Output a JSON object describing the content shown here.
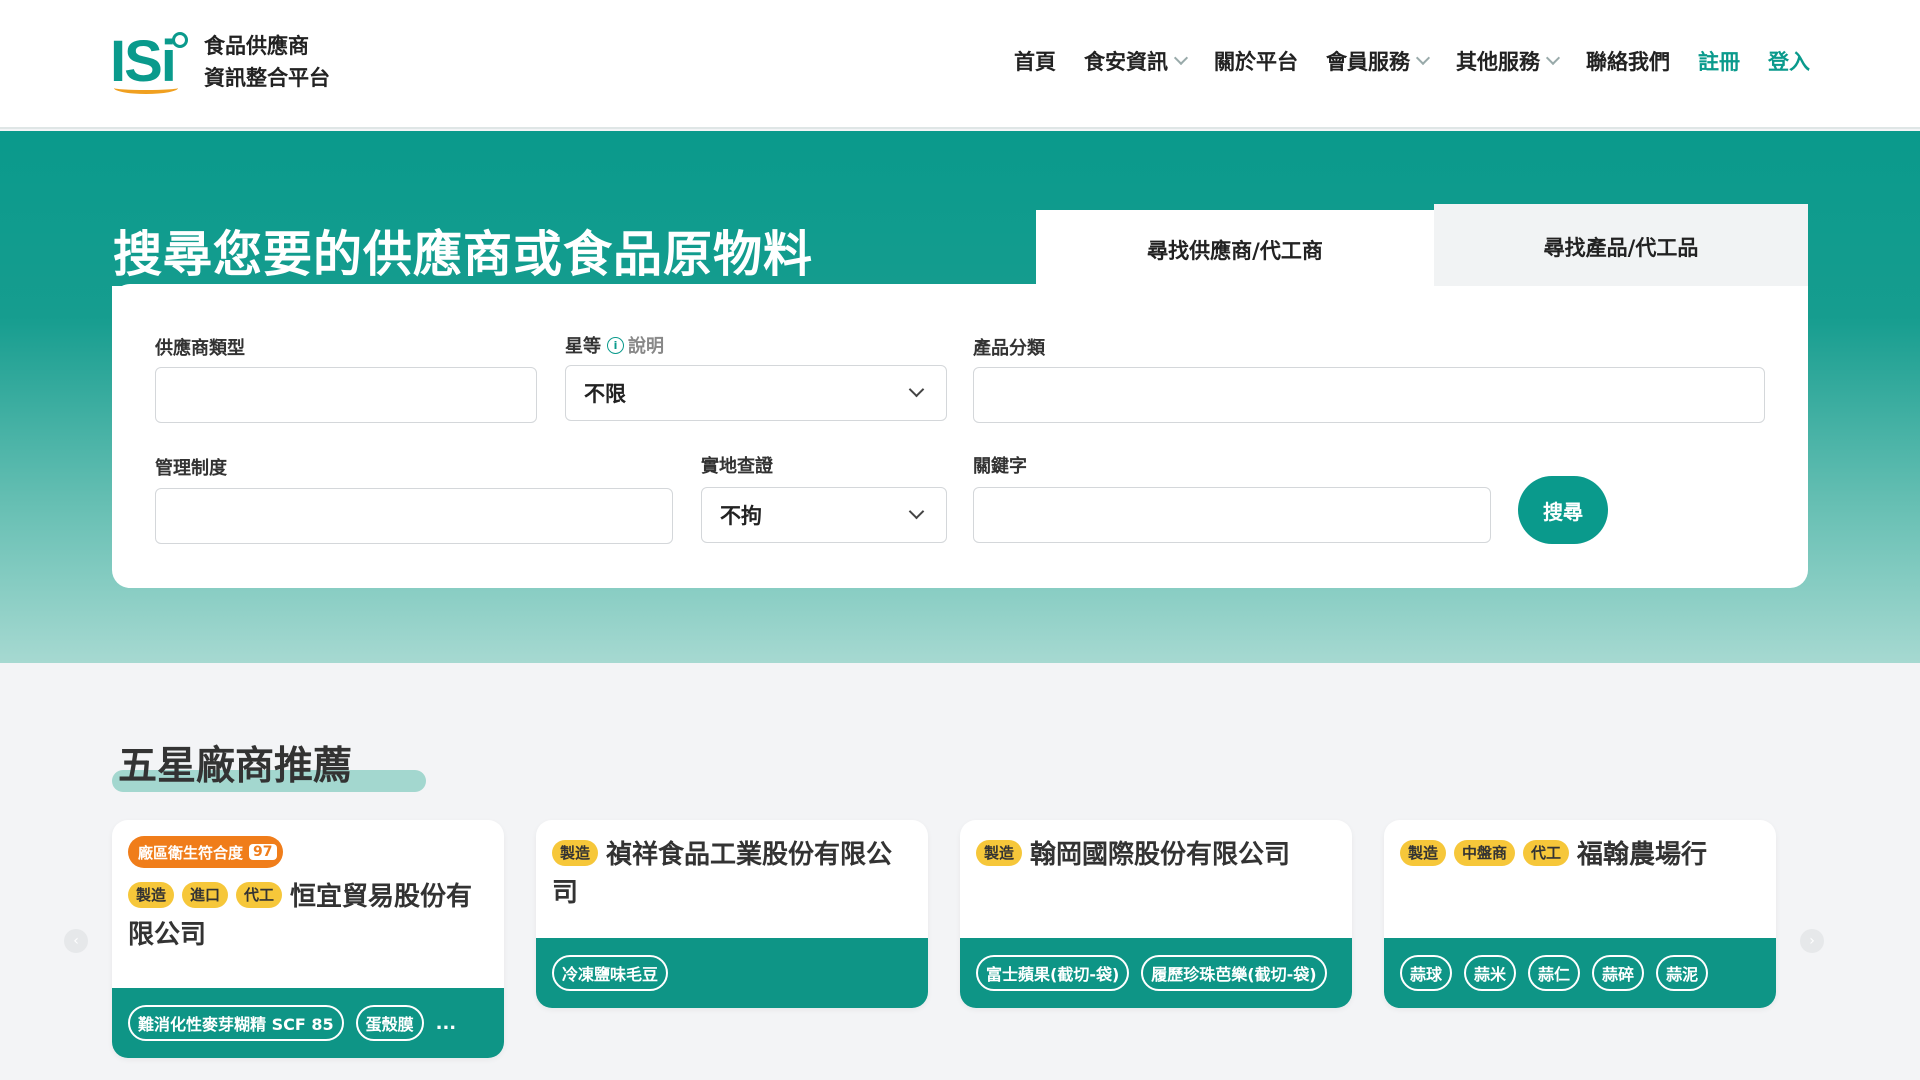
{
  "header": {
    "logo_mark": "ISi",
    "logo_line1": "食品供應商",
    "logo_line2": "資訊整合平台",
    "nav": [
      {
        "label": "首頁",
        "dropdown": false
      },
      {
        "label": "食安資訊",
        "dropdown": true
      },
      {
        "label": "關於平台",
        "dropdown": false
      },
      {
        "label": "會員服務",
        "dropdown": true
      },
      {
        "label": "其他服務",
        "dropdown": true
      },
      {
        "label": "聯絡我們",
        "dropdown": false
      }
    ],
    "register": "註冊",
    "login": "登入"
  },
  "hero": {
    "title": "搜尋您要的供應商或食品原物料",
    "tabs": [
      "尋找供應商/代工商",
      "尋找產品/代工品"
    ]
  },
  "form": {
    "supplier_type_label": "供應商類型",
    "star_label": "星等",
    "star_help": "說明",
    "star_value": "不限",
    "category_label": "產品分類",
    "management_label": "管理制度",
    "inspection_label": "實地查證",
    "inspection_value": "不拘",
    "keyword_label": "關鍵字",
    "search_button": "搜尋"
  },
  "recommend": {
    "title": "五星廠商推薦",
    "cards": [
      {
        "hygiene_label": "廠區衛生符合度",
        "hygiene_score": "97",
        "badges": [
          "製造",
          "進口",
          "代工"
        ],
        "name": "恒宜貿易股份有限公司",
        "tags": [
          "難消化性麥芽糊精 SCF 85",
          "蛋殼膜"
        ],
        "more": "..."
      },
      {
        "badges": [
          "製造"
        ],
        "name": "禎祥食品工業股份有限公司",
        "tags": [
          "冷凍鹽味毛豆"
        ]
      },
      {
        "badges": [
          "製造"
        ],
        "name": "翰岡國際股份有限公司",
        "tags": [
          "富士蘋果(截切-袋)",
          "履歷珍珠芭樂(截切-袋)"
        ]
      },
      {
        "badges": [
          "製造",
          "中盤商",
          "代工"
        ],
        "name": "福翰農場行",
        "tags": [
          "蒜球",
          "蒜米",
          "蒜仁",
          "蒜碎",
          "蒜泥"
        ]
      }
    ]
  },
  "colors": {
    "brand": "#0a9a8c",
    "badge_yellow": "#f6c73a",
    "hygiene_orange": "#f07d1a"
  }
}
